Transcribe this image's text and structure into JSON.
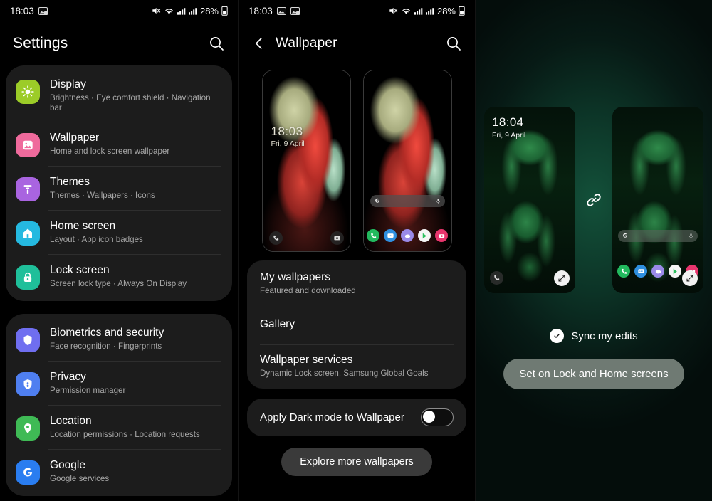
{
  "status_bar": {
    "time_left": "18:03",
    "time_middle": "18:03",
    "battery_percent": "28%",
    "icons": [
      "image-icon",
      "screenshot-icon",
      "mute-icon",
      "wifi-icon",
      "signal-icon",
      "signal-icon",
      "battery-icon"
    ]
  },
  "settings_panel": {
    "title": "Settings",
    "search_icon": "search-icon",
    "cards": [
      {
        "items": [
          {
            "title": "Display",
            "subtitle": "Brightness  ·  Eye comfort shield  ·  Navigation bar",
            "icon": "brightness-icon",
            "color": "#9ccc28"
          },
          {
            "title": "Wallpaper",
            "subtitle": "Home and lock screen wallpaper",
            "icon": "image-icon",
            "color": "#ef6a9c"
          },
          {
            "title": "Themes",
            "subtitle": "Themes  ·  Wallpapers  ·  Icons",
            "icon": "paint-roller-icon",
            "color": "#a964e0"
          },
          {
            "title": "Home screen",
            "subtitle": "Layout  ·  App icon badges",
            "icon": "home-icon",
            "color": "#25b9e0"
          },
          {
            "title": "Lock screen",
            "subtitle": "Screen lock type  ·  Always On Display",
            "icon": "lock-icon",
            "color": "#1fbf9a"
          }
        ]
      },
      {
        "items": [
          {
            "title": "Biometrics and security",
            "subtitle": "Face recognition  ·  Fingerprints",
            "icon": "shield-icon",
            "color": "#6f6ef0"
          },
          {
            "title": "Privacy",
            "subtitle": "Permission manager",
            "icon": "privacy-shield-icon",
            "color": "#4f7ff0"
          },
          {
            "title": "Location",
            "subtitle": "Location permissions  ·  Location requests",
            "icon": "map-pin-icon",
            "color": "#3fba55"
          },
          {
            "title": "Google",
            "subtitle": "Google services",
            "icon": "google-g-icon",
            "color": "#2a7df0"
          }
        ]
      }
    ]
  },
  "wallpaper_panel": {
    "title": "Wallpaper",
    "back_icon": "back-chevron-icon",
    "search_icon": "search-icon",
    "previews": {
      "lock": {
        "time": "18:03",
        "date": "Fri, 9 April",
        "shortcut_left": "phone-icon",
        "shortcut_right": "camera-icon"
      },
      "home": {
        "dock_apps": [
          "phone-icon",
          "messages-icon",
          "contacts-icon",
          "play-store-icon",
          "camera-icon"
        ],
        "search_left_icon": "google-icon",
        "search_right_icon": "mic-icon"
      }
    },
    "sources": [
      {
        "title": "My wallpapers",
        "subtitle": "Featured and downloaded"
      },
      {
        "title": "Gallery",
        "subtitle": ""
      },
      {
        "title": "Wallpaper services",
        "subtitle": "Dynamic Lock screen, Samsung Global Goals"
      }
    ],
    "dark_mode_toggle": {
      "label": "Apply Dark mode to Wallpaper",
      "state": "off"
    },
    "explore_button": "Explore more wallpapers"
  },
  "preview_panel": {
    "lock": {
      "time": "18:04",
      "date": "Fri, 9 April",
      "lock_icon": "phone-icon",
      "expand_icon": "expand-icon"
    },
    "home": {
      "dock_apps": [
        "phone-icon",
        "messages-icon",
        "contacts-icon",
        "play-store-icon",
        "camera-icon"
      ],
      "expand_icon": "expand-icon",
      "search_left_icon": "google-icon",
      "search_right_icon": "mic-icon"
    },
    "link_icon": "link-icon",
    "sync": {
      "label": "Sync my edits",
      "icon": "check-circle-icon",
      "checked": true
    },
    "set_button": "Set on Lock and Home screens"
  },
  "colors": {
    "card_bg": "#1c1c1c",
    "panel_bg": "#000000",
    "accent_green": "#13513a",
    "set_button_bg": "#6f7a73"
  }
}
